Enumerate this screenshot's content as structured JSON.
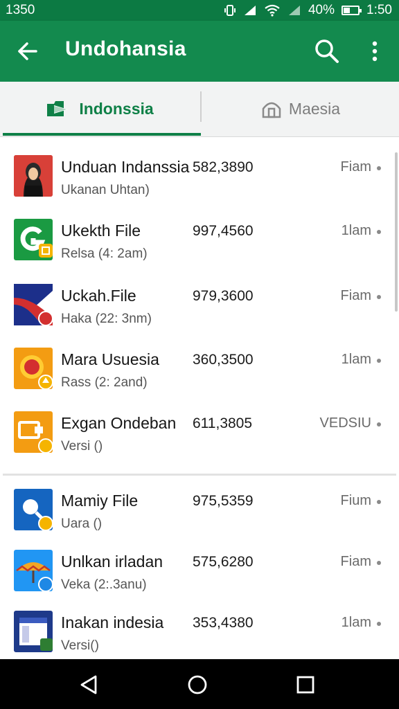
{
  "status_bar": {
    "left_text": "1350",
    "battery_text": "40%",
    "battery_level": 0.4,
    "time": "1:50",
    "icons": [
      "vibrate-icon",
      "signal-icon",
      "wifi-icon",
      "signal-icon",
      "battery-icon"
    ]
  },
  "app_bar": {
    "title": "Undohansia",
    "back_icon": "arrow-back-icon",
    "search_icon": "search-icon",
    "more_icon": "more-vert-icon",
    "color": "#138a4e"
  },
  "tabs": [
    {
      "label": "Indonssia",
      "icon": "flag-icon",
      "selected": true
    },
    {
      "label": "Maesia",
      "icon": "home-icon",
      "selected": false
    }
  ],
  "items": [
    {
      "name": "Unduan Indanssia",
      "sub": "Ukanan Uhtan)",
      "number": "582,3890",
      "time": "Fiam",
      "icon": "person-photo-icon"
    },
    {
      "name": "Ukekth File",
      "sub": "Relsa (4: 2am)",
      "number": "997,4560",
      "time": "1lam",
      "icon": "g-logo-icon"
    },
    {
      "name": "Uckah.File",
      "sub": "Haka (22: 3nm)",
      "number": "979,3600",
      "time": "Fiam",
      "icon": "stripes-logo-icon"
    },
    {
      "name": "Mara Usuesia",
      "sub": "Rass (2: 2and)",
      "number": "360,3500",
      "time": "1lam",
      "icon": "gear-logo-icon"
    },
    {
      "name": "Exgan Ondeban",
      "sub": "Versi ()",
      "number": "611,3805",
      "time": "VEDSIU",
      "icon": "folder-logo-icon"
    },
    {
      "name": "Mamiy File",
      "sub": "Uara ()",
      "number": "975,5359",
      "time": "Fium",
      "icon": "magnifier-logo-icon"
    },
    {
      "name": "Unlkan irladan",
      "sub": "Veka (2:.3anu)",
      "number": "575,6280",
      "time": "Fiam",
      "icon": "umbrella-logo-icon"
    },
    {
      "name": "Inakan indesia",
      "sub": "Versi()",
      "number": "353,4380",
      "time": "1lam",
      "icon": "window-logo-icon"
    }
  ],
  "nav_bar": {
    "back": "nav-back-icon",
    "home": "nav-home-icon",
    "recents": "nav-recents-icon"
  }
}
